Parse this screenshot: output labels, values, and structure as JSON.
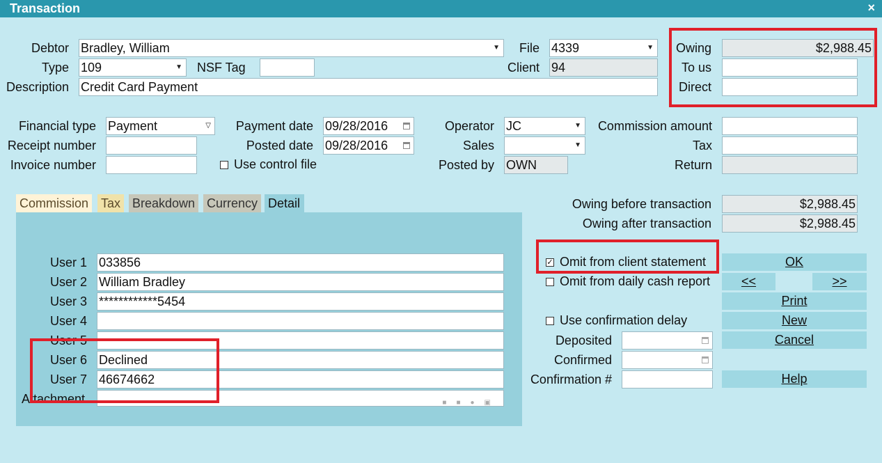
{
  "window": {
    "title": "Transaction",
    "close": "×"
  },
  "header": {
    "debtor_label": "Debtor",
    "debtor_value": "Bradley, William",
    "type_label": "Type",
    "type_value": "109",
    "nsf_tag_label": "NSF Tag",
    "nsf_tag_value": "",
    "description_label": "Description",
    "description_value": "Credit Card Payment",
    "file_label": "File",
    "file_value": "4339",
    "client_label": "Client",
    "client_value": "94",
    "owing_label": "Owing",
    "owing_value": "$2,988.45",
    "to_us_label": "To us",
    "to_us_value": "",
    "direct_label": "Direct",
    "direct_value": ""
  },
  "financial": {
    "financial_type_label": "Financial type",
    "financial_type_value": "Payment",
    "receipt_number_label": "Receipt number",
    "receipt_number_value": "",
    "invoice_number_label": "Invoice number",
    "invoice_number_value": "",
    "payment_date_label": "Payment date",
    "payment_date_value": "09/28/2016",
    "posted_date_label": "Posted date",
    "posted_date_value": "09/28/2016",
    "use_control_file_label": "Use control file",
    "operator_label": "Operator",
    "operator_value": "JC",
    "sales_label": "Sales",
    "sales_value": "",
    "posted_by_label": "Posted by",
    "posted_by_value": "OWN",
    "commission_amount_label": "Commission amount",
    "commission_amount_value": "",
    "tax_label": "Tax",
    "tax_value": "",
    "return_label": "Return",
    "return_value": ""
  },
  "tabs": [
    "Commission",
    "Tax",
    "Breakdown",
    "Currency",
    "Detail"
  ],
  "detail": {
    "user1_label": "User 1",
    "user1_value": "033856",
    "user2_label": "User 2",
    "user2_value": "William Bradley",
    "user3_label": "User 3",
    "user3_value": "************5454",
    "user4_label": "User 4",
    "user4_value": "",
    "user5_label": "User 5",
    "user5_value": "",
    "user6_label": "User 6",
    "user6_value": "Declined",
    "user7_label": "User 7",
    "user7_value": "46674662",
    "attachment_label": "Attachment"
  },
  "summary": {
    "owing_before_label": "Owing before transaction",
    "owing_before_value": "$2,988.45",
    "owing_after_label": "Owing after transaction",
    "owing_after_value": "$2,988.45"
  },
  "options": {
    "omit_client_statement_label": "Omit from client statement",
    "omit_client_statement_checked": "✓",
    "omit_daily_cash_label": "Omit from daily cash report",
    "use_confirmation_delay_label": "Use confirmation delay",
    "deposited_label": "Deposited",
    "deposited_value": "",
    "confirmed_label": "Confirmed",
    "confirmed_value": "",
    "confirmation_no_label": "Confirmation #",
    "confirmation_no_value": ""
  },
  "buttons": {
    "ok": "OK",
    "prev": "<<",
    "next": ">>",
    "print": "Print",
    "new": "New",
    "cancel": "Cancel",
    "help": "Help"
  },
  "colors": {
    "titlebar": "#2a97ad",
    "background": "#c5e9f1",
    "highlight": "#e0202a"
  }
}
